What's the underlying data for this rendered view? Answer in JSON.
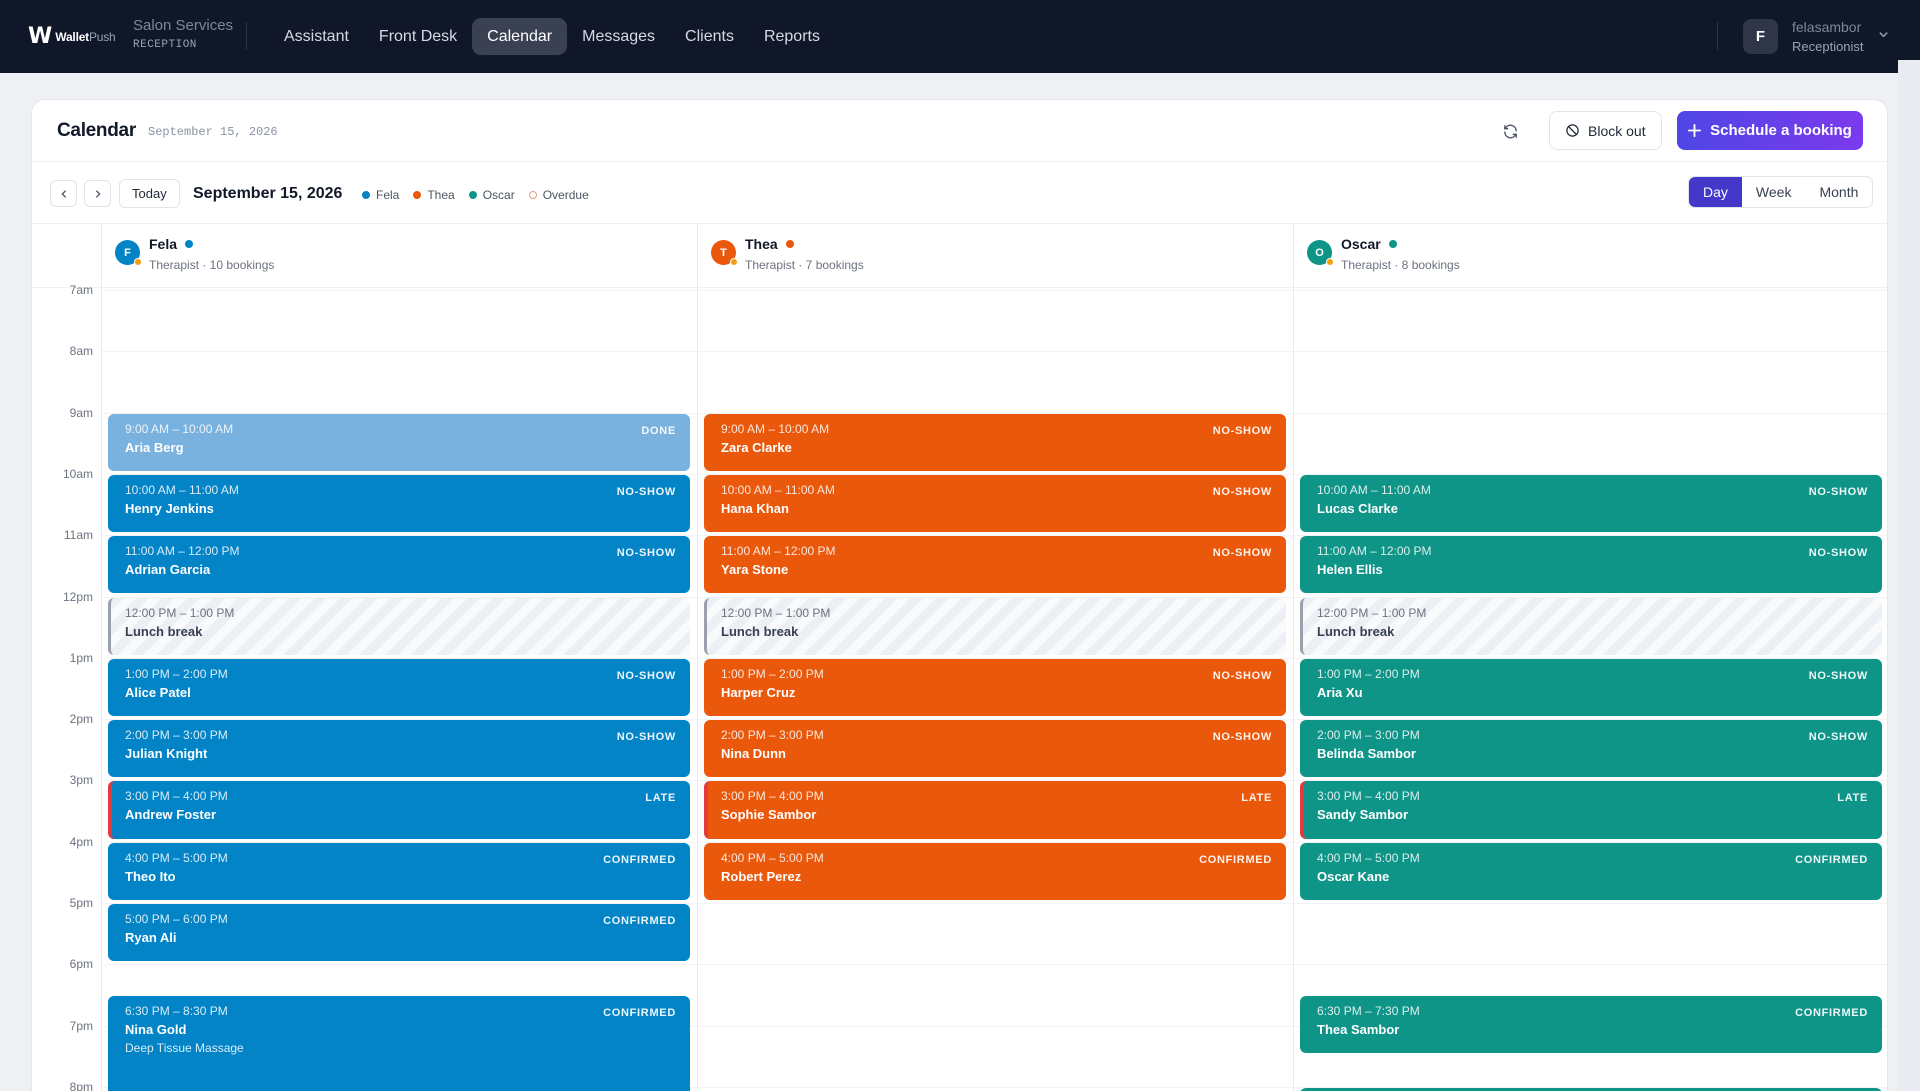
{
  "brand": {
    "mark": "W",
    "name_bold": "Wallet",
    "name_light": "Push"
  },
  "context": {
    "title": "Salon Services",
    "subtitle": "RECEPTION"
  },
  "nav": [
    {
      "label": "Assistant"
    },
    {
      "label": "Front Desk"
    },
    {
      "label": "Calendar",
      "active": true
    },
    {
      "label": "Messages"
    },
    {
      "label": "Clients"
    },
    {
      "label": "Reports"
    }
  ],
  "user": {
    "initial": "F",
    "name": "felasambor",
    "role": "Receptionist"
  },
  "header": {
    "title": "Calendar",
    "date": "September 15, 2026",
    "block_out_label": "Block out",
    "schedule_label": "Schedule a booking"
  },
  "toolbar": {
    "today_label": "Today",
    "date": "September 15, 2026",
    "legend": [
      {
        "label": "Fela",
        "color": "#0284c7"
      },
      {
        "label": "Thea",
        "color": "#ea580c"
      },
      {
        "label": "Oscar",
        "color": "#0f9488"
      },
      {
        "label": "Overdue",
        "color": "#e89b80",
        "ring": true
      }
    ],
    "views": [
      {
        "label": "Day",
        "active": true
      },
      {
        "label": "Week"
      },
      {
        "label": "Month"
      }
    ]
  },
  "time_labels": [
    "7am",
    "8am",
    "9am",
    "10am",
    "11am",
    "12pm",
    "1pm",
    "2pm",
    "3pm",
    "4pm",
    "5pm",
    "6pm",
    "7pm",
    "8pm"
  ],
  "therapists": [
    {
      "name": "Fela",
      "initial": "F",
      "color": "#0284c7",
      "subtitle": "Therapist · 10 bookings",
      "bookings": [
        {
          "time": "9:00 AM – 10:00 AM",
          "client": "Aria Berg",
          "status": "DONE",
          "start": 9,
          "end": 10,
          "kind": "done"
        },
        {
          "time": "10:00 AM – 11:00 AM",
          "client": "Henry Jenkins",
          "status": "NO-SHOW",
          "start": 10,
          "end": 11
        },
        {
          "time": "11:00 AM – 12:00 PM",
          "client": "Adrian Garcia",
          "status": "NO-SHOW",
          "start": 11,
          "end": 12
        },
        {
          "time": "12:00 PM – 1:00 PM",
          "client": "Lunch break",
          "status": "",
          "start": 12,
          "end": 13,
          "kind": "break"
        },
        {
          "time": "1:00 PM – 2:00 PM",
          "client": "Alice Patel",
          "status": "NO-SHOW",
          "start": 13,
          "end": 14
        },
        {
          "time": "2:00 PM – 3:00 PM",
          "client": "Julian Knight",
          "status": "NO-SHOW",
          "start": 14,
          "end": 15
        },
        {
          "time": "3:00 PM – 4:00 PM",
          "client": "Andrew Foster",
          "status": "LATE",
          "start": 15,
          "end": 16,
          "kind": "late"
        },
        {
          "time": "4:00 PM – 5:00 PM",
          "client": "Theo Ito",
          "status": "CONFIRMED",
          "start": 16,
          "end": 17
        },
        {
          "time": "5:00 PM – 6:00 PM",
          "client": "Ryan Ali",
          "status": "CONFIRMED",
          "start": 17,
          "end": 18
        },
        {
          "time": "6:30 PM – 8:30 PM",
          "client": "Nina Gold",
          "service": "Deep Tissue Massage",
          "status": "CONFIRMED",
          "start": 18.5,
          "end": 20.5
        }
      ]
    },
    {
      "name": "Thea",
      "initial": "T",
      "color": "#ea580c",
      "subtitle": "Therapist · 7 bookings",
      "bookings": [
        {
          "time": "9:00 AM – 10:00 AM",
          "client": "Zara Clarke",
          "status": "NO-SHOW",
          "start": 9,
          "end": 10
        },
        {
          "time": "10:00 AM – 11:00 AM",
          "client": "Hana Khan",
          "status": "NO-SHOW",
          "start": 10,
          "end": 11
        },
        {
          "time": "11:00 AM – 12:00 PM",
          "client": "Yara Stone",
          "status": "NO-SHOW",
          "start": 11,
          "end": 12
        },
        {
          "time": "12:00 PM – 1:00 PM",
          "client": "Lunch break",
          "status": "",
          "start": 12,
          "end": 13,
          "kind": "break"
        },
        {
          "time": "1:00 PM – 2:00 PM",
          "client": "Harper Cruz",
          "status": "NO-SHOW",
          "start": 13,
          "end": 14
        },
        {
          "time": "2:00 PM – 3:00 PM",
          "client": "Nina Dunn",
          "status": "NO-SHOW",
          "start": 14,
          "end": 15
        },
        {
          "time": "3:00 PM – 4:00 PM",
          "client": "Sophie Sambor",
          "status": "LATE",
          "start": 15,
          "end": 16,
          "kind": "late"
        },
        {
          "time": "4:00 PM – 5:00 PM",
          "client": "Robert Perez",
          "status": "CONFIRMED",
          "start": 16,
          "end": 17
        }
      ]
    },
    {
      "name": "Oscar",
      "initial": "O",
      "color": "#0f9488",
      "subtitle": "Therapist · 8 bookings",
      "bookings": [
        {
          "time": "10:00 AM – 11:00 AM",
          "client": "Lucas Clarke",
          "status": "NO-SHOW",
          "start": 10,
          "end": 11
        },
        {
          "time": "11:00 AM – 12:00 PM",
          "client": "Helen Ellis",
          "status": "NO-SHOW",
          "start": 11,
          "end": 12
        },
        {
          "time": "12:00 PM – 1:00 PM",
          "client": "Lunch break",
          "status": "",
          "start": 12,
          "end": 13,
          "kind": "break"
        },
        {
          "time": "1:00 PM – 2:00 PM",
          "client": "Aria Xu",
          "status": "NO-SHOW",
          "start": 13,
          "end": 14
        },
        {
          "time": "2:00 PM – 3:00 PM",
          "client": "Belinda Sambor",
          "status": "NO-SHOW",
          "start": 14,
          "end": 15
        },
        {
          "time": "3:00 PM – 4:00 PM",
          "client": "Sandy Sambor",
          "status": "LATE",
          "start": 15,
          "end": 16,
          "kind": "late"
        },
        {
          "time": "4:00 PM – 5:00 PM",
          "client": "Oscar Kane",
          "status": "CONFIRMED",
          "start": 16,
          "end": 17
        },
        {
          "time": "6:30 PM – 7:30 PM",
          "client": "Thea Sambor",
          "status": "CONFIRMED",
          "start": 18.5,
          "end": 19.5
        },
        {
          "time": "",
          "client": "",
          "status": "",
          "start": 20,
          "end": 21
        }
      ]
    }
  ]
}
